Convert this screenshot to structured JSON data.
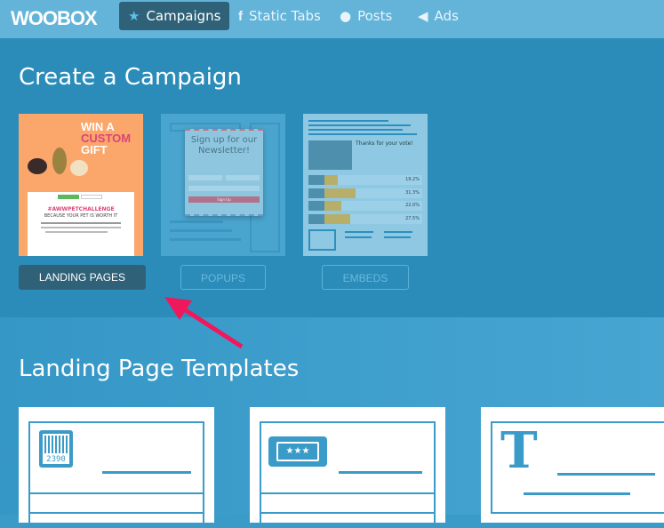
{
  "nav": {
    "logo": "WOOBOX",
    "items": [
      {
        "label": "Campaigns",
        "icon": "star-icon",
        "active": true
      },
      {
        "label": "Static Tabs",
        "icon": "facebook-icon",
        "active": false
      },
      {
        "label": "Posts",
        "icon": "speech-bubble-icon",
        "active": false
      },
      {
        "label": "Ads",
        "icon": "megaphone-icon",
        "active": false
      }
    ]
  },
  "create": {
    "title": "Create a Campaign",
    "cards": [
      {
        "label": "LANDING PAGES",
        "active": true,
        "preview": {
          "headline1": "WIN A",
          "headline2": "CUSTOM",
          "headline3": "GIFT",
          "hashtag": "#AWWPETCHALLENGE",
          "sub": "BECAUSE YOUR PET IS WORTH IT"
        }
      },
      {
        "label": "POPUPS",
        "active": false,
        "preview": {
          "title": "Sign up for our Newsletter!",
          "button": "Sign Up"
        }
      },
      {
        "label": "EMBEDS",
        "active": false,
        "preview": {
          "title": "Thanks for your vote!",
          "results": [
            {
              "pct": "19.2%",
              "value": 19.2
            },
            {
              "pct": "31.3%",
              "value": 31.3
            },
            {
              "pct": "22.0%",
              "value": 22.0
            },
            {
              "pct": "27.5%",
              "value": 27.5
            }
          ]
        }
      }
    ]
  },
  "templates": {
    "title": "Landing Page Templates",
    "items": [
      {
        "icon": "barcode-coupon-icon",
        "code": "2390"
      },
      {
        "icon": "ticket-icon",
        "stars": "★★★"
      },
      {
        "icon": "text-t-icon",
        "glyph": "T"
      }
    ]
  },
  "colors": {
    "nav": "#64b4d9",
    "active": "#2f6279",
    "section": "#2b8cb9",
    "annotation_arrow": "#f0185c"
  }
}
